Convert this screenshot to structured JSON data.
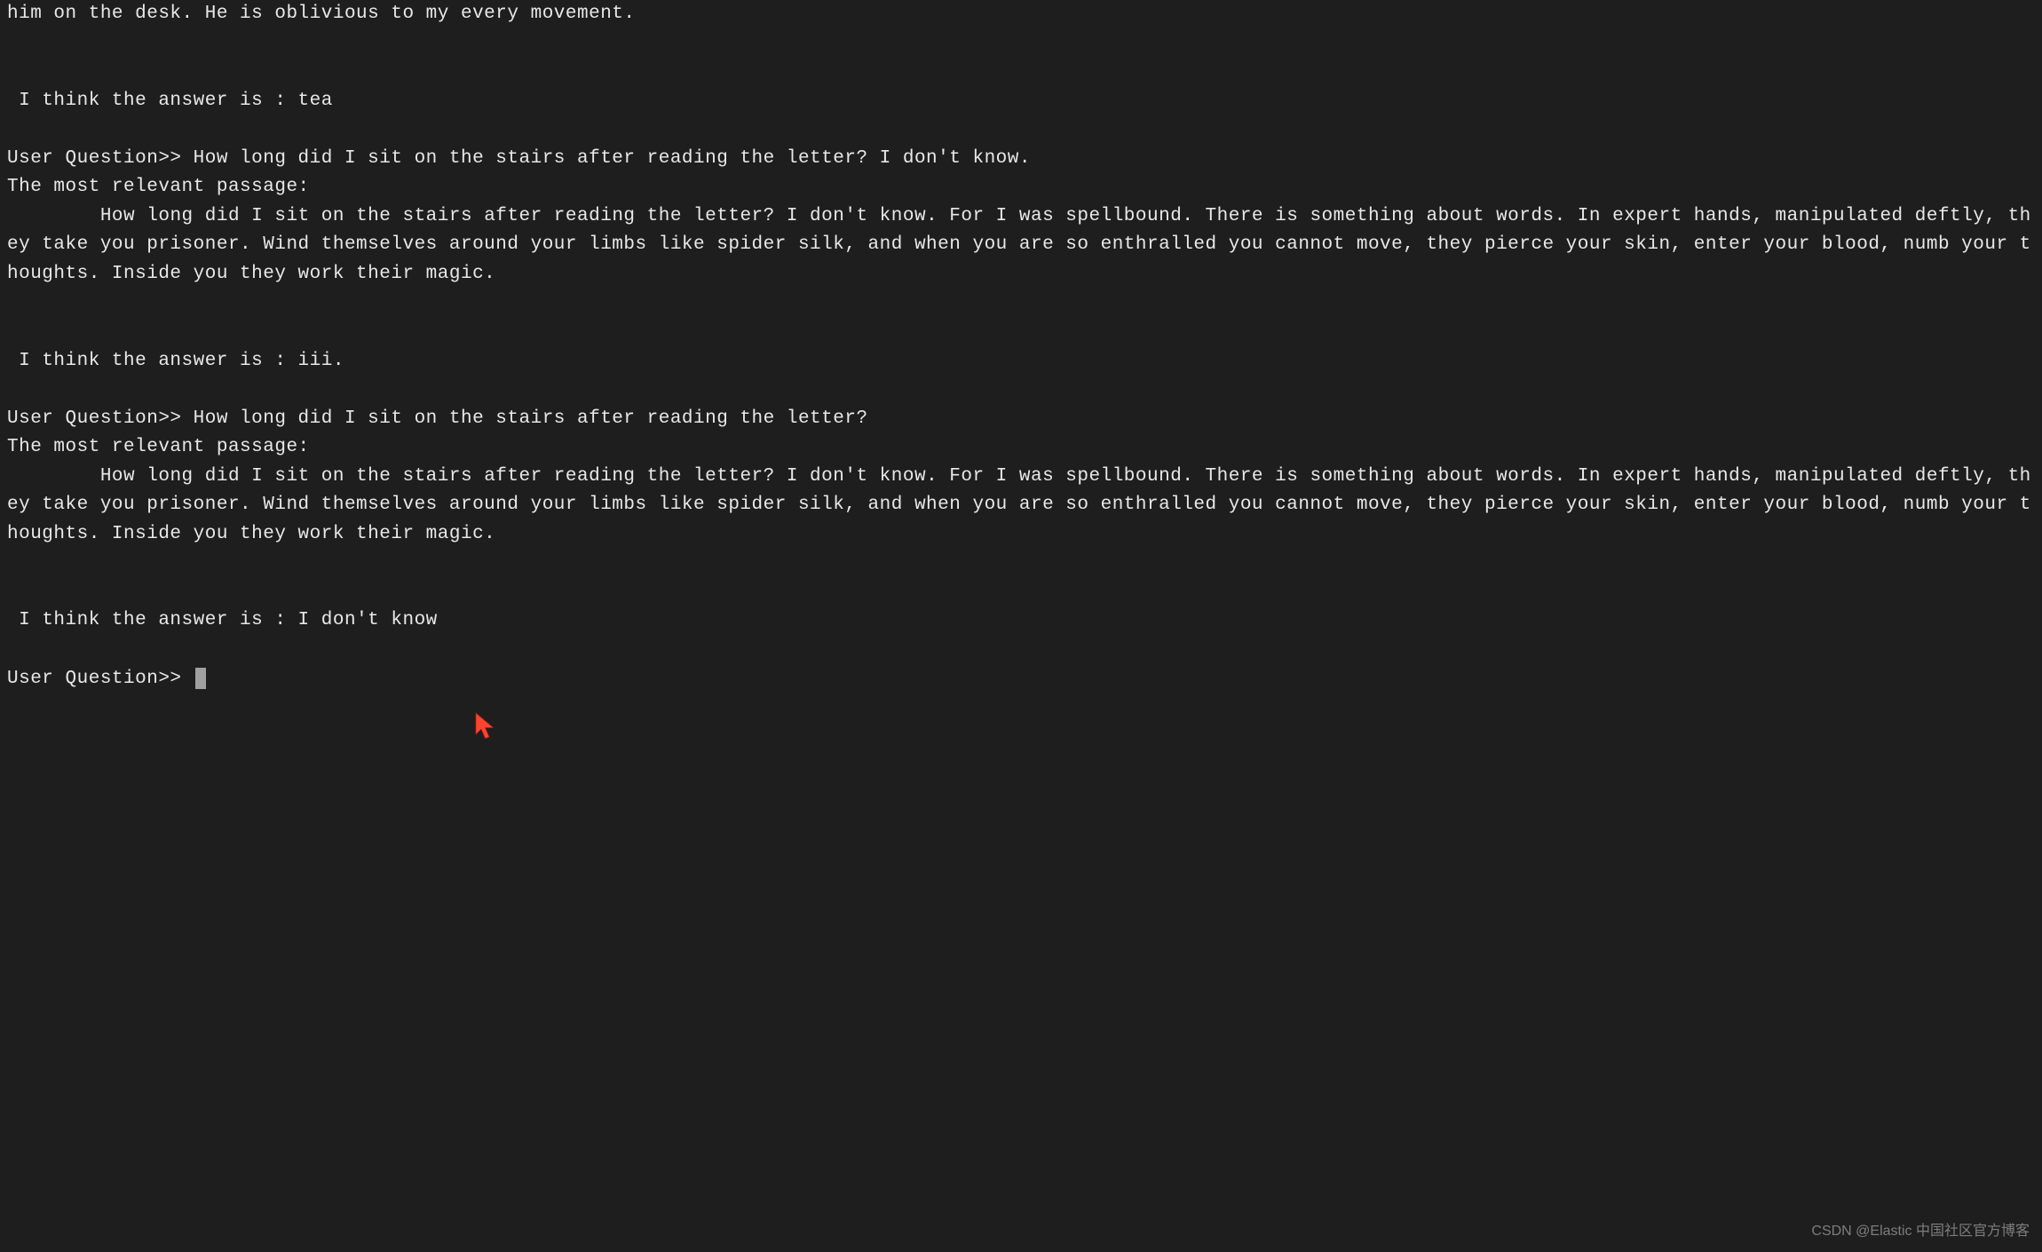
{
  "blocks": [
    {
      "type": "line",
      "text": "him on the desk. He is oblivious to my every movement."
    },
    {
      "type": "blank"
    },
    {
      "type": "blank"
    },
    {
      "type": "line",
      "text": " I think the answer is : tea"
    },
    {
      "type": "blank"
    },
    {
      "type": "line",
      "text": "User Question>> How long did I sit on the stairs after reading the letter? I don't know."
    },
    {
      "type": "line",
      "text": "The most relevant passage: "
    },
    {
      "type": "line",
      "text": "        How long did I sit on the stairs after reading the letter? I don't know. For I was spellbound. There is something about words. In expert hands, manipulated deftly, they take you prisoner. Wind themselves around your limbs like spider silk, and when you are so enthralled you cannot move, they pierce your skin, enter your blood, numb your thoughts. Inside you they work their magic."
    },
    {
      "type": "blank"
    },
    {
      "type": "blank"
    },
    {
      "type": "line",
      "text": " I think the answer is : iii."
    },
    {
      "type": "blank"
    },
    {
      "type": "line",
      "text": "User Question>> How long did I sit on the stairs after reading the letter?"
    },
    {
      "type": "line",
      "text": "The most relevant passage: "
    },
    {
      "type": "line",
      "text": "        How long did I sit on the stairs after reading the letter? I don't know. For I was spellbound. There is something about words. In expert hands, manipulated deftly, they take you prisoner. Wind themselves around your limbs like spider silk, and when you are so enthralled you cannot move, they pierce your skin, enter your blood, numb your thoughts. Inside you they work their magic."
    },
    {
      "type": "blank"
    },
    {
      "type": "blank"
    },
    {
      "type": "line",
      "text": " I think the answer is : I don't know"
    },
    {
      "type": "blank"
    }
  ],
  "prompt": {
    "label": "User Question>> "
  },
  "watermark": "CSDN @Elastic 中国社区官方博客"
}
